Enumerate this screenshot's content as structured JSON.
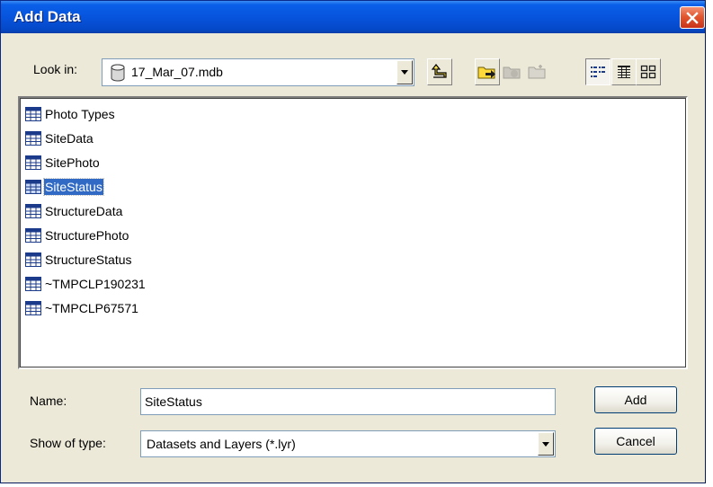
{
  "window": {
    "title": "Add Data"
  },
  "look_in": {
    "label": "Look in:",
    "value": "17_Mar_07.mdb"
  },
  "toolbar": {
    "icons": [
      "up-one-level-icon",
      "connect-folder-icon",
      "disconnect-folder-icon",
      "new-folder-icon",
      "list-view-icon",
      "details-view-icon",
      "thumbnails-view-icon"
    ]
  },
  "files": [
    {
      "name": "Photo Types",
      "selected": false
    },
    {
      "name": "SiteData",
      "selected": false
    },
    {
      "name": "SitePhoto",
      "selected": false
    },
    {
      "name": "SiteStatus",
      "selected": true
    },
    {
      "name": "StructureData",
      "selected": false
    },
    {
      "name": "StructurePhoto",
      "selected": false
    },
    {
      "name": "StructureStatus",
      "selected": false
    },
    {
      "name": "~TMPCLP190231",
      "selected": false
    },
    {
      "name": "~TMPCLP67571",
      "selected": false
    }
  ],
  "name_field": {
    "label": "Name:",
    "value": "SiteStatus"
  },
  "type_field": {
    "label": "Show of type:",
    "value": "Datasets and Layers (*.lyr)"
  },
  "buttons": {
    "add": "Add",
    "cancel": "Cancel"
  },
  "colors": {
    "titlebar": "#0754dd",
    "selection": "#316ac5",
    "dialog_bg": "#ece9d8"
  }
}
